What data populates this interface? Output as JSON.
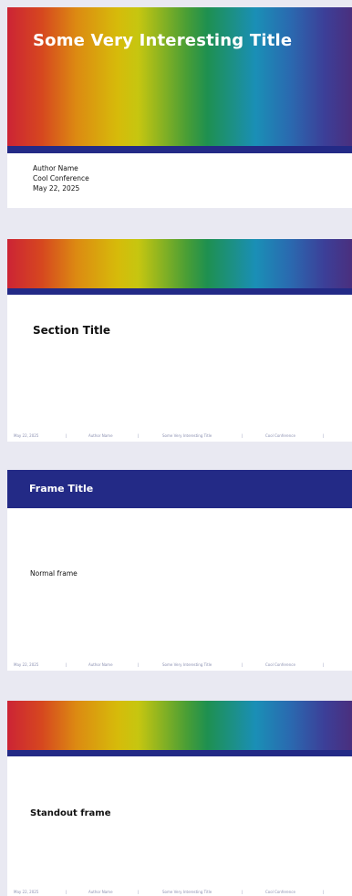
{
  "title_slide": {
    "title": "Some Very Interesting Title",
    "author": "Author Name",
    "conference": "Cool Conference",
    "date": "May 22, 2025"
  },
  "section_slide": {
    "heading": "Section Title"
  },
  "frame_slide": {
    "frame_title": "Frame Title",
    "body": "Normal frame"
  },
  "standout_slide": {
    "heading": "Standout frame"
  },
  "footer": {
    "date": "May 22, 2025",
    "author": "Author Name",
    "title": "Some Very Interesting Title",
    "conference": "Cool Conference",
    "separator": "|"
  },
  "colors": {
    "band": "#232a86",
    "background": "#e9e9f2",
    "footer_text": "#8a8fb0"
  }
}
